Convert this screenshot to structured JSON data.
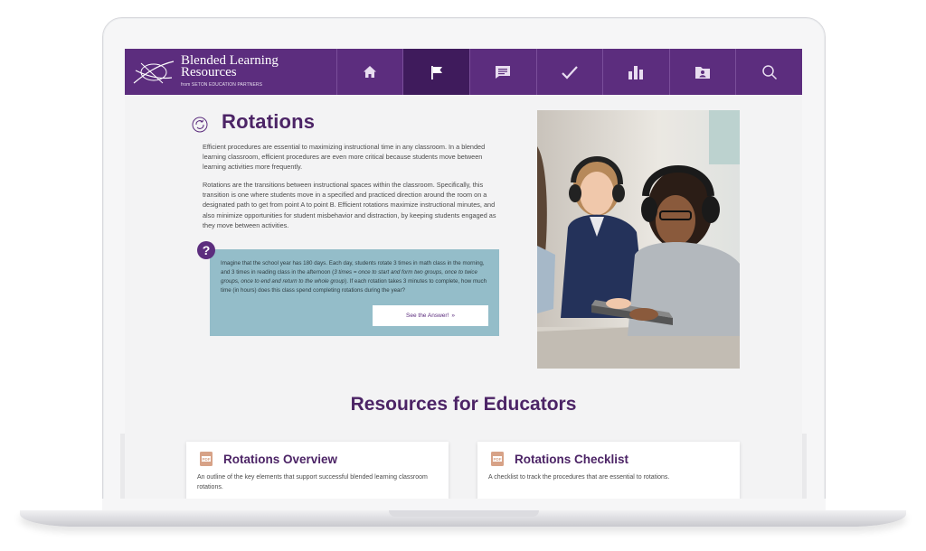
{
  "brand": {
    "title": "Blended Learning Resources",
    "subtitle": "from SETON EDUCATION PARTNERS"
  },
  "nav": {
    "items": [
      {
        "icon": "home-icon",
        "active": false
      },
      {
        "icon": "flag-icon",
        "active": true
      },
      {
        "icon": "message-list-icon",
        "active": false
      },
      {
        "icon": "check-icon",
        "active": false
      },
      {
        "icon": "bar-chart-icon",
        "active": false
      },
      {
        "icon": "folder-user-icon",
        "active": false
      },
      {
        "icon": "search-icon",
        "active": false
      }
    ]
  },
  "main": {
    "title": "Rotations",
    "paragraph1": "Efficient procedures are essential to maximizing instructional time in any classroom. In a blended learning classroom, efficient procedures are even more critical because students move between learning activities more frequently.",
    "paragraph2": "Rotations are the transitions between instructional spaces within the classroom. Specifically, this transition is one where students move in a specified and practiced direction around the room on a designated path to get from point A to point B. Efficient rotations maximize instructional minutes, and also minimize opportunities for student misbehavior and distraction, by keeping students engaged as they move between activities.",
    "question": {
      "text_a": "Imagine that the school year has 180 days. Each day, students rotate 3 times in math class in the morning, and 3 times in reading class in the afternoon (",
      "text_italic": "3 times = once to start and form two groups, once to twice groups, once to end and return to the whole group",
      "text_b": "). If each rotation takes 3 minutes to complete, how much time (in hours) does this class spend completing rotations during the year?",
      "button_label": "See the Answer!",
      "button_icon": "»"
    }
  },
  "resources": {
    "title": "Resources for Educators",
    "cards": [
      {
        "title": "Rotations Overview",
        "description": "An outline of the key elements that support successful blended learning classroom rotations.",
        "icon_label": "PDF"
      },
      {
        "title": "Rotations Checklist",
        "description": "A checklist to track the procedures that are essential to rotations.",
        "icon_label": "PDF"
      }
    ]
  },
  "colors": {
    "brand_purple": "#5c2d7e",
    "active_nav": "#3f1b5c",
    "question_box": "#94bdc9",
    "pdf_icon": "#d7a287"
  }
}
